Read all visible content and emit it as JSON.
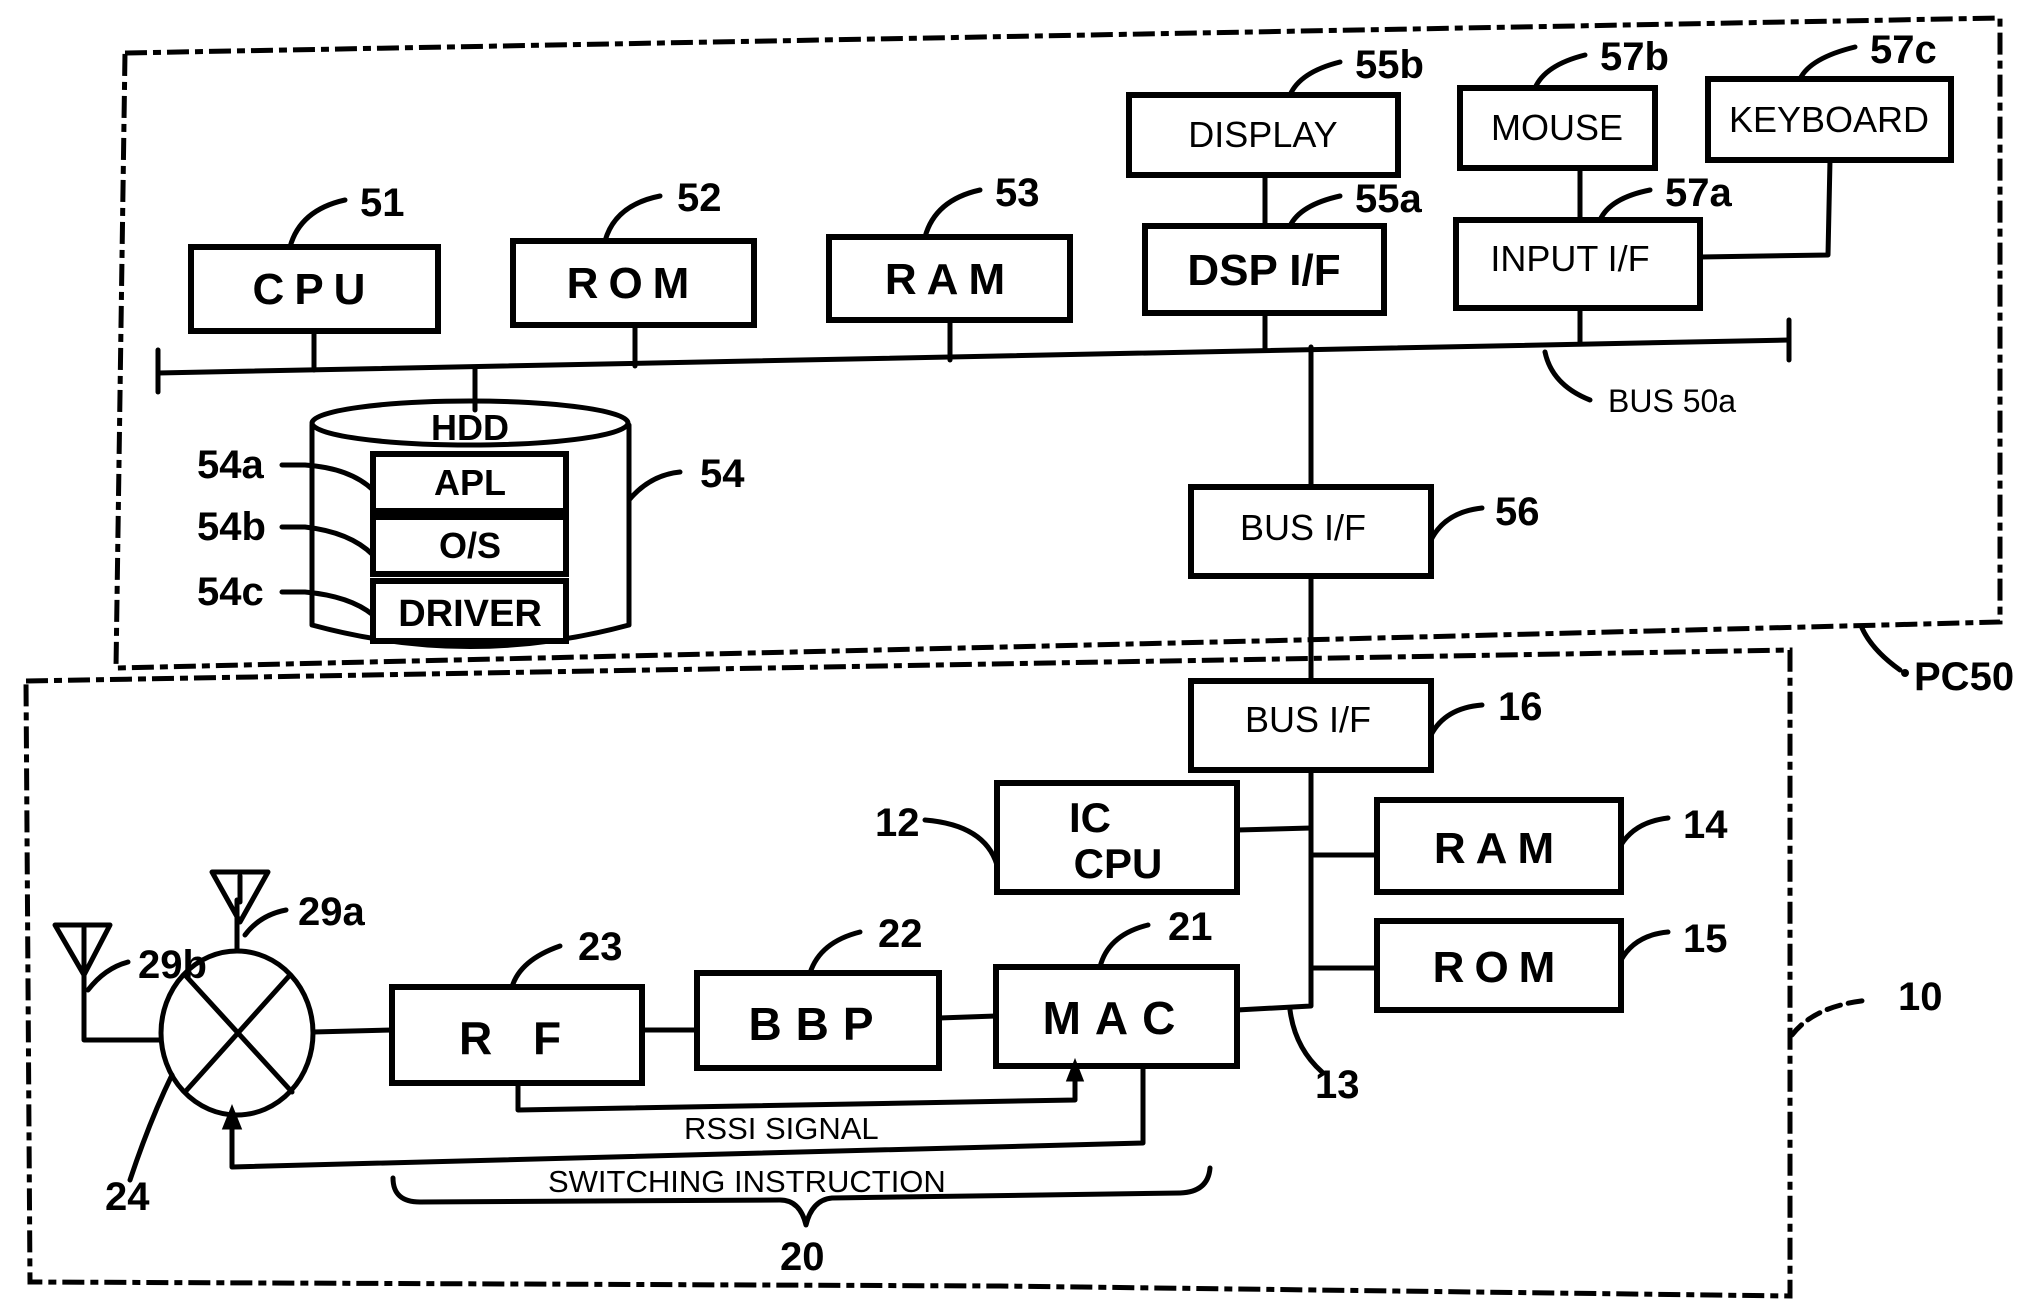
{
  "diagram": {
    "pc": {
      "ref": "PC50",
      "bus_label": "BUS 50a",
      "blocks": {
        "cpu": {
          "label": "CPU",
          "ref": "51"
        },
        "rom": {
          "label": "ROM",
          "ref": "52"
        },
        "ram": {
          "label": "RAM",
          "ref": "53"
        },
        "display": {
          "label": "DISPLAY",
          "ref": "55b"
        },
        "dsp_if": {
          "label": "DSP I/F",
          "ref": "55a"
        },
        "mouse": {
          "label": "MOUSE",
          "ref": "57b"
        },
        "keyboard": {
          "label": "KEYBOARD",
          "ref": "57c"
        },
        "input_if": {
          "label": "INPUT I/F",
          "ref": "57a"
        },
        "bus_if": {
          "label": "BUS I/F",
          "ref": "56"
        }
      },
      "hdd": {
        "label": "HDD",
        "ref": "54",
        "partitions": [
          {
            "label": "APL",
            "ref": "54a"
          },
          {
            "label": "O/S",
            "ref": "54b"
          },
          {
            "label": "DRIVER",
            "ref": "54c"
          }
        ]
      }
    },
    "card": {
      "ref": "10",
      "bus_ref": "13",
      "blocks": {
        "bus_if": {
          "label": "BUS I/F",
          "ref": "16"
        },
        "ic_cpu": {
          "line1": "IC",
          "line2": "CPU",
          "ref": "12"
        },
        "ram": {
          "label": "RAM",
          "ref": "14"
        },
        "rom": {
          "label": "ROM",
          "ref": "15"
        },
        "mac": {
          "label": "MAC",
          "ref": "21"
        },
        "bbp": {
          "label": "BBP",
          "ref": "22"
        },
        "rf": {
          "label": "R F",
          "ref": "23"
        }
      },
      "switch_ref": "24",
      "antennas": [
        {
          "ref": "29a"
        },
        {
          "ref": "29b"
        }
      ],
      "signals": {
        "rssi": "RSSI SIGNAL",
        "switching": "SWITCHING INSTRUCTION"
      },
      "group_ref": "20"
    }
  }
}
